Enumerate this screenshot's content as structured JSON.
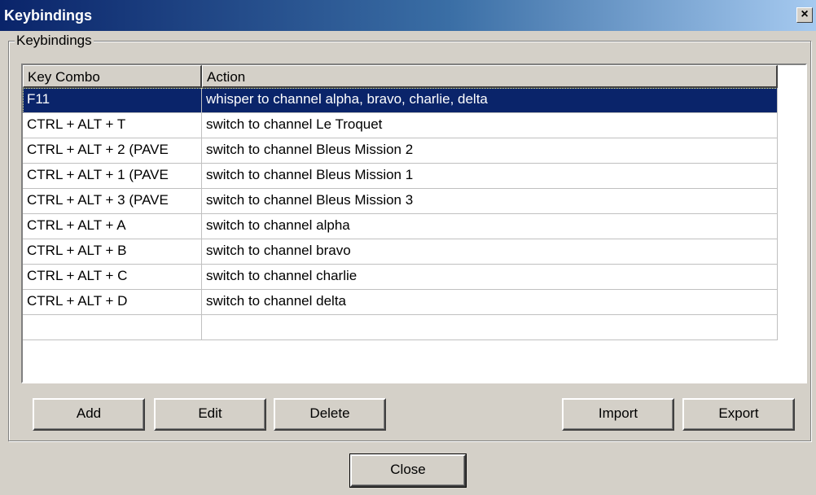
{
  "window": {
    "title": "Keybindings",
    "close_glyph": "×",
    "close_icon": "close-icon"
  },
  "group": {
    "label": "Keybindings"
  },
  "list": {
    "columns": [
      "Key Combo",
      "Action"
    ],
    "selected_index": 0,
    "rows": [
      {
        "key": "F11",
        "action": "whisper to channel alpha, bravo, charlie, delta"
      },
      {
        "key": "CTRL + ALT + T",
        "action": "switch to channel Le Troquet"
      },
      {
        "key": "CTRL + ALT + 2 (PAVE",
        "action": "switch to channel Bleus Mission 2"
      },
      {
        "key": "CTRL + ALT + 1 (PAVE",
        "action": "switch to channel Bleus Mission 1"
      },
      {
        "key": "CTRL + ALT + 3 (PAVE",
        "action": "switch to channel Bleus Mission 3"
      },
      {
        "key": "CTRL + ALT + A",
        "action": "switch to channel alpha"
      },
      {
        "key": "CTRL + ALT + B",
        "action": "switch to channel bravo"
      },
      {
        "key": "CTRL + ALT + C",
        "action": "switch to channel charlie"
      },
      {
        "key": "CTRL + ALT + D",
        "action": "switch to channel delta"
      },
      {
        "key": "",
        "action": ""
      }
    ]
  },
  "buttons": {
    "add": "Add",
    "edit": "Edit",
    "delete": "Delete",
    "import": "Import",
    "export": "Export",
    "close": "Close"
  },
  "colors": {
    "dialog_bg": "#d4d0c8",
    "title_gradient_start": "#0a246a",
    "title_gradient_end": "#a6caf0",
    "selection_bg": "#0a246a",
    "selection_text": "#ffffff"
  }
}
